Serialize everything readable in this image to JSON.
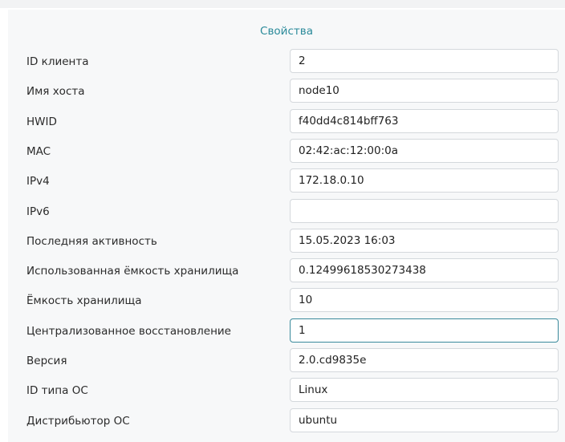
{
  "panel": {
    "title": "Свойства"
  },
  "properties": [
    {
      "label": "ID клиента",
      "value": "2"
    },
    {
      "label": "Имя хоста",
      "value": "node10"
    },
    {
      "label": "HWID",
      "value": "f40dd4c814bff763"
    },
    {
      "label": "MAC",
      "value": "02:42:ac:12:00:0a"
    },
    {
      "label": "IPv4",
      "value": "172.18.0.10"
    },
    {
      "label": "IPv6",
      "value": ""
    },
    {
      "label": "Последняя активность",
      "value": "15.05.2023 16:03"
    },
    {
      "label": "Использованная ёмкость хранилища",
      "value": "0.12499618530273438"
    },
    {
      "label": "Ёмкость хранилища",
      "value": "10"
    },
    {
      "label": "Централизованное восстановление",
      "value": "1",
      "focused": true
    },
    {
      "label": "Версия",
      "value": "2.0.cd9835e"
    },
    {
      "label": "ID типа ОС",
      "value": "Linux"
    },
    {
      "label": "Дистрибьютор ОС",
      "value": "ubuntu"
    }
  ],
  "colors": {
    "accent": "#2a8a9a",
    "focus_border": "#3a8a9c",
    "input_border": "#d4d8dc",
    "panel_background": "#f7f8f9"
  }
}
